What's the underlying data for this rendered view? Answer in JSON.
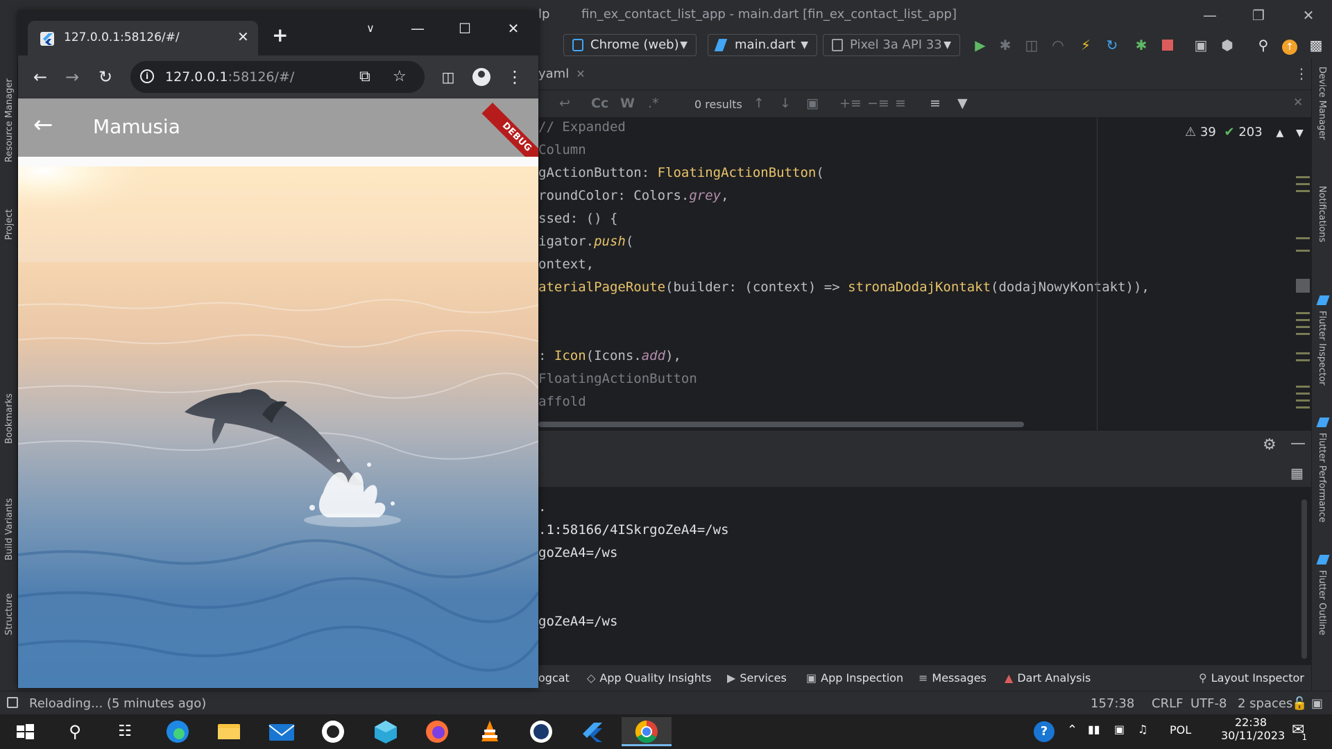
{
  "ide": {
    "menu_fragment": "lp",
    "window_title": "fin_ex_contact_list_app - main.dart [fin_ex_contact_list_app]",
    "toolbar": {
      "device_selector": "Chrome (web)",
      "run_config": "main.dart",
      "emulator_selector": "Pixel 3a API 33"
    },
    "tab_fragment": "yaml",
    "find": {
      "results": "0 results",
      "case_label": "Cc",
      "word_label": "W",
      "regex_label": ".*"
    },
    "inspections": {
      "warnings": "39",
      "ok": "203"
    },
    "code_lines": [
      {
        "text": "// Expanded",
        "cls": "c-comment"
      },
      {
        "text": "Column",
        "cls": "c-comment"
      },
      {
        "html_parts": [
          [
            "gActionButton: ",
            ""
          ],
          [
            "FloatingActionButton",
            "c-yellow"
          ],
          [
            "(",
            ""
          ]
        ]
      },
      {
        "html_parts": [
          [
            "roundColor: Colors.",
            ""
          ],
          [
            "grey",
            "c-purple"
          ],
          [
            ",",
            ""
          ]
        ]
      },
      {
        "html_parts": [
          [
            "ssed: () {",
            ""
          ]
        ]
      },
      {
        "html_parts": [
          [
            "igator.",
            ""
          ],
          [
            "push",
            "c-italic-y"
          ],
          [
            "(",
            ""
          ]
        ]
      },
      {
        "html_parts": [
          [
            "ontext,",
            ""
          ]
        ]
      },
      {
        "html_parts": [
          [
            "aterialPageRoute",
            "c-yellow"
          ],
          [
            "(builder: (context) => ",
            ""
          ],
          [
            "stronaDodajKontakt",
            "c-yellow"
          ],
          [
            "(dodajNowyKontakt)),",
            ""
          ]
        ]
      },
      {
        "html_parts": [
          [
            "",
            ""
          ]
        ]
      },
      {
        "html_parts": [
          [
            "",
            ""
          ]
        ]
      },
      {
        "html_parts": [
          [
            ": ",
            ""
          ],
          [
            "Icon",
            "c-yellow"
          ],
          [
            "(Icons.",
            ""
          ],
          [
            "add",
            "c-purple"
          ],
          [
            "),",
            ""
          ]
        ]
      },
      {
        "text": "FloatingActionButton",
        "cls": "c-comment"
      },
      {
        "text": "affold",
        "cls": "c-comment"
      }
    ],
    "console_lines": [
      {
        "text": "."
      },
      {
        "text": ".1:58166/4ISkrgoZeA4=/ws"
      },
      {
        "text": "goZeA4=/ws"
      },
      {
        "text": ""
      },
      {
        "text": ""
      },
      {
        "text": "goZeA4=/ws"
      }
    ],
    "bottom_tools": {
      "logcat": "ogcat",
      "quality": "App Quality Insights",
      "services": "Services",
      "inspection": "App Inspection",
      "messages": "Messages",
      "dart": "Dart Analysis",
      "layout": "Layout Inspector"
    },
    "status": {
      "reloading": "Reloading... (5 minutes ago)",
      "position": "157:38",
      "line_ending": "CRLF",
      "encoding": "UTF-8",
      "indent": "2 spaces"
    },
    "left_panels": {
      "resource_manager": "Resource Manager",
      "project": "Project",
      "bookmarks": "Bookmarks",
      "build_variants": "Build Variants",
      "structure": "Structure"
    },
    "right_panels": {
      "device_manager": "Device Manager",
      "notifications": "Notifications",
      "flutter_inspector": "Flutter Inspector",
      "flutter_performance": "Flutter Performance",
      "flutter_outline": "Flutter Outline"
    }
  },
  "browser": {
    "tab_title": "127.0.0.1:58126/#/",
    "url_host": "127.0.0.1",
    "url_rest": ":58126/#/"
  },
  "app": {
    "title": "Mamusia",
    "debug_banner": "DEBUG",
    "appbar_color": "#9e9e9e"
  },
  "taskbar": {
    "language": "POL",
    "time": "22:38",
    "date": "30/11/2023",
    "notification_count": "1"
  }
}
